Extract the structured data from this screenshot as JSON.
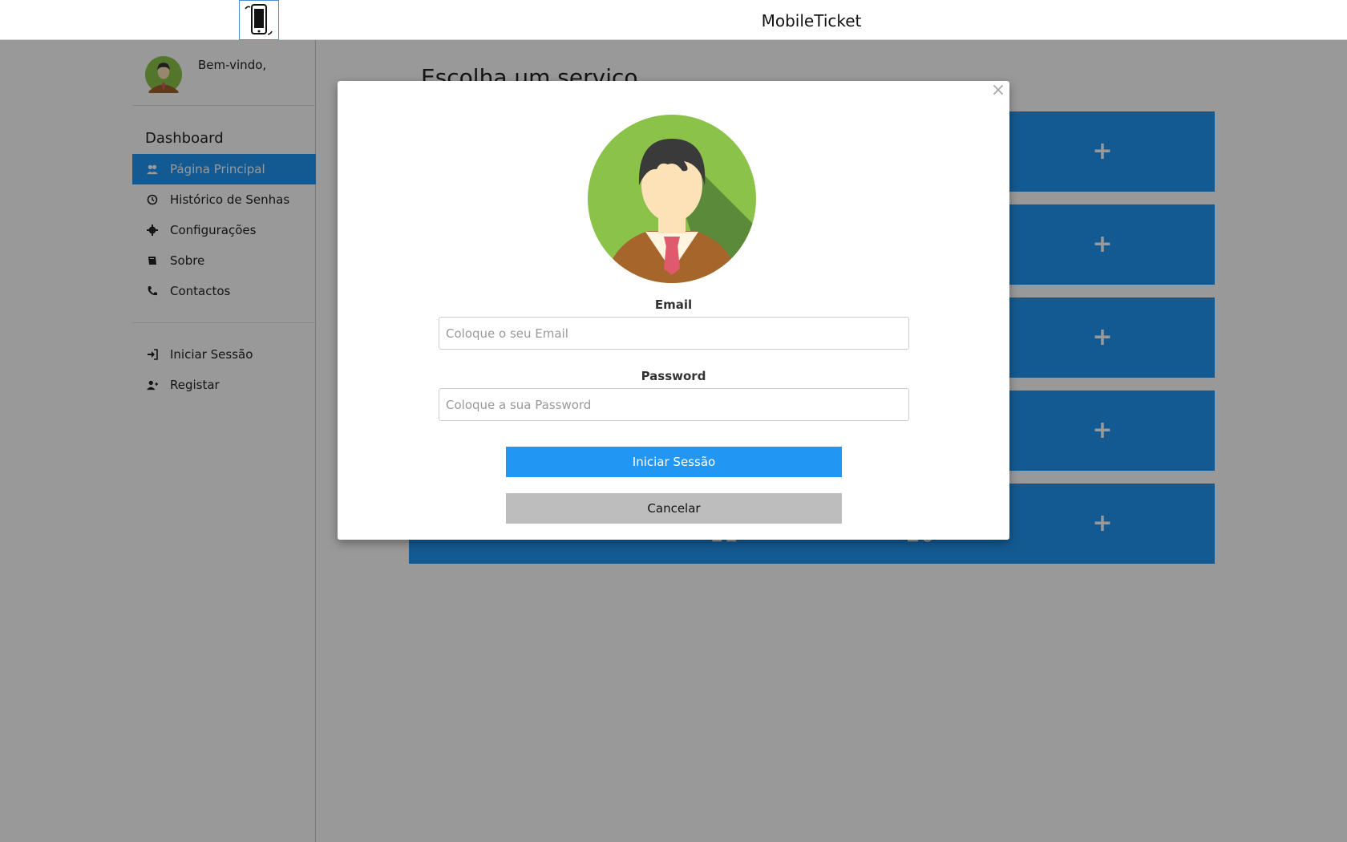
{
  "header": {
    "app_title": "MobileTicket",
    "logo_icon": "phone-icon"
  },
  "sidebar": {
    "welcome": "Bem-vindo,",
    "dashboard_title": "Dashboard",
    "nav_items": [
      {
        "label": "Página Principal",
        "icon": "users-icon",
        "active": true
      },
      {
        "label": "Histórico de Senhas",
        "icon": "history-icon",
        "active": false
      },
      {
        "label": "Configurações",
        "icon": "gear-icon",
        "active": false
      },
      {
        "label": "Sobre",
        "icon": "book-icon",
        "active": false
      },
      {
        "label": "Contactos",
        "icon": "phone-call-icon",
        "active": false
      }
    ],
    "account_items": [
      {
        "label": "Iniciar Sessão",
        "icon": "sign-in-icon"
      },
      {
        "label": "Registar",
        "icon": "user-plus-icon"
      }
    ]
  },
  "main": {
    "heading": "Escolha um serviço",
    "service_count": 5,
    "partial_numbers": [
      "11",
      "20"
    ]
  },
  "modal": {
    "email_label": "Email",
    "email_placeholder": "Coloque o seu Email",
    "password_label": "Password",
    "password_placeholder": "Coloque a sua Password",
    "login_button": "Iniciar Sessão",
    "cancel_button": "Cancelar",
    "close_symbol": "×"
  },
  "colors": {
    "accent": "#2196f3",
    "cancel": "#bdbdbd",
    "overlay": "rgba(0,0,0,0.4)"
  }
}
